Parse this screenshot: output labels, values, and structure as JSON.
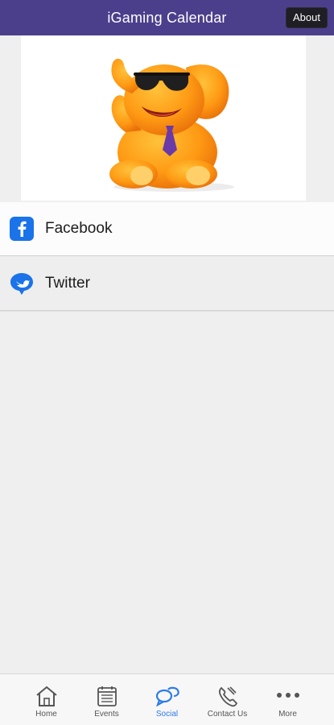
{
  "header": {
    "title": "iGaming Calendar",
    "about_label": "About"
  },
  "colors": {
    "header_bg": "#4b3f8c",
    "accent": "#2d7be8",
    "facebook": "#1a73e8"
  },
  "banner": {
    "image": "orange-elephant-mascot"
  },
  "social_links": [
    {
      "label": "Facebook",
      "icon": "facebook-icon"
    },
    {
      "label": "Twitter",
      "icon": "twitter-bird-icon"
    }
  ],
  "tabs": [
    {
      "label": "Home",
      "icon": "home-icon",
      "active": false
    },
    {
      "label": "Events",
      "icon": "calendar-list-icon",
      "active": false
    },
    {
      "label": "Social",
      "icon": "chat-bubbles-icon",
      "active": true
    },
    {
      "label": "Contact Us",
      "icon": "phone-icon",
      "active": false
    },
    {
      "label": "More",
      "icon": "more-dots-icon",
      "active": false
    }
  ]
}
